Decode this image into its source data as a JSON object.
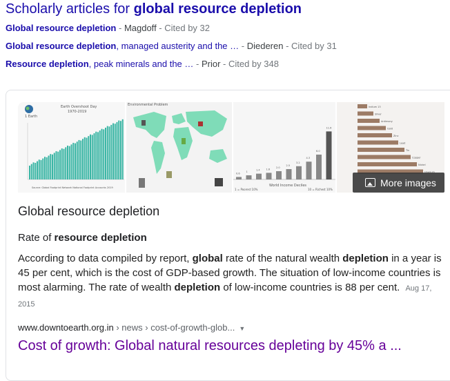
{
  "scholarly": {
    "prefix": "Scholarly articles for ",
    "query": "global resource depletion",
    "rows": [
      {
        "bold_link": "Global resource depletion",
        "link_rest": "",
        "sep": " - ",
        "author": "Magdoff",
        "cited": " - Cited by 32"
      },
      {
        "bold_link": "Global resource depletion",
        "link_rest": ", managed austerity and the …",
        "sep": " - ",
        "author": "Diederen",
        "cited": " - Cited by 31"
      },
      {
        "bold_link": "Resource depletion",
        "link_rest": ", peak minerals and the …",
        "sep": " - ",
        "author": "Prior",
        "cited": " - Cited by 348"
      }
    ]
  },
  "images": {
    "more_label": "More images",
    "img1": {
      "title": "Earth Overshoot Day",
      "years": "1970-2019",
      "legend": "1 Earth",
      "source": "Source: Global Footprint Network National Footprint Accounts 2019"
    },
    "img2": {
      "title": "Environmental Problem"
    },
    "img3": {
      "axis_label": "World Income Deciles",
      "left_label": "1 = Poorest 10%",
      "right_label": "10 = Richest 10%",
      "bar_values": [
        "0.6",
        "1",
        "1.4",
        "1.6",
        "2.0",
        "2.5",
        "3.2",
        "4.3",
        "6.0",
        "11.6"
      ]
    },
    "img4": {
      "labels": [
        "Indium 13",
        "Silver",
        "Antimony",
        "Gold",
        "Zinc",
        "Lead",
        "Tin",
        "Copper",
        "Nickel",
        "Uranium"
      ]
    }
  },
  "knowledge": {
    "title": "Global resource depletion",
    "subtitle_plain": "Rate of ",
    "subtitle_bold": "resource depletion",
    "text_parts": [
      {
        "t": "According to data compiled by report, ",
        "b": false
      },
      {
        "t": "global",
        "b": true
      },
      {
        "t": " rate of the natural wealth ",
        "b": false
      },
      {
        "t": "depletion",
        "b": true
      },
      {
        "t": " in a year is 45 per cent, which is the cost of GDP-based growth. The situation of low-income countries is most alarming. The rate of wealth ",
        "b": false
      },
      {
        "t": "depletion",
        "b": true
      },
      {
        "t": " of low-income countries is 88 per cent.",
        "b": false
      }
    ],
    "date": "Aug 17, 2015"
  },
  "result": {
    "domain": "www.downtoearth.org.in",
    "path": " › news › cost-of-growth-glob...",
    "dropdown_icon": "triangle-down-icon",
    "title": "Cost of growth: Global natural resources depleting by 45% a ..."
  },
  "colors": {
    "link": "#1a0dab",
    "visited": "#660099",
    "teal": "#39b5a4",
    "map_green": "#7fdcb8"
  }
}
